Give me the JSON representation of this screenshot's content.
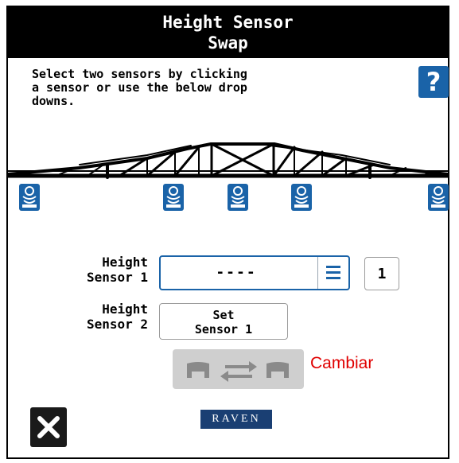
{
  "title_line1": "Height Sensor",
  "title_line2": "Swap",
  "instructions": "Select two sensors by clicking\na sensor or use the below drop\ndowns.",
  "help_label": "?",
  "sensor1_label_line1": "Height",
  "sensor1_label_line2": "Sensor 1",
  "sensor1_value": "----",
  "sensor1_number": "1",
  "sensor2_label_line1": "Height",
  "sensor2_label_line2": "Sensor 2",
  "set_button_line1": "Set",
  "set_button_line2": "Sensor 1",
  "swap_annotation": "Cambiar",
  "brand_logo": "RAVEN",
  "accent_color": "#1a63a8",
  "swap_button_color": "#cfcfcf",
  "icons": [
    "help-icon",
    "boom-frame",
    "height-sensor-icon",
    "menu-icon",
    "swap-arrows-icon",
    "close-icon"
  ]
}
